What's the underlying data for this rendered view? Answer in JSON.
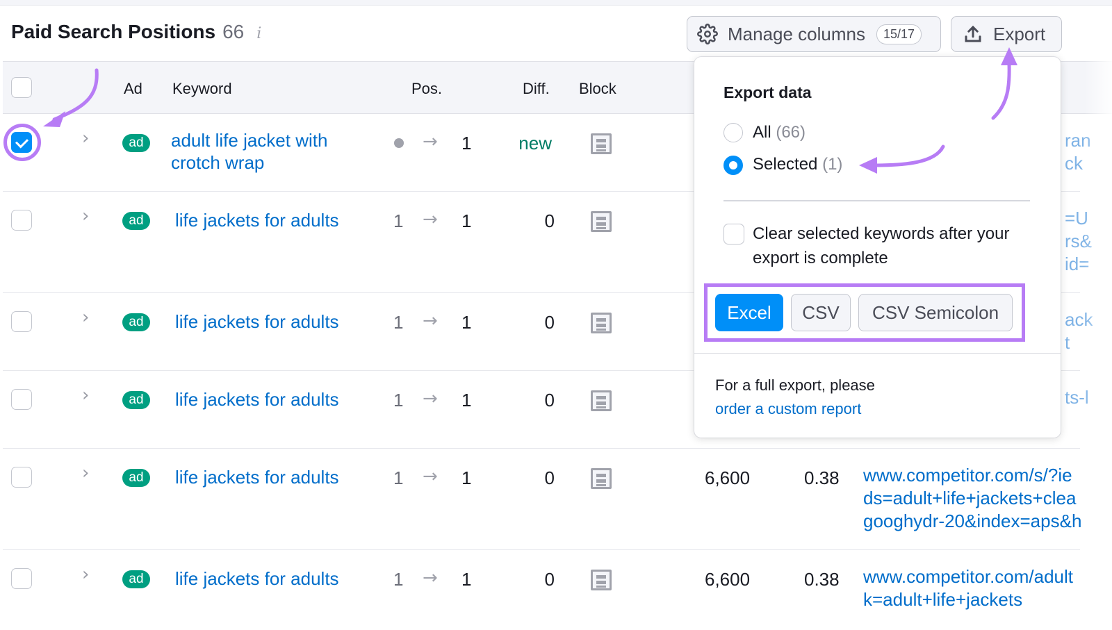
{
  "header": {
    "title": "Paid Search Positions",
    "count": "66",
    "info_icon": "i"
  },
  "toolbar": {
    "manage_columns_label": "Manage columns",
    "manage_columns_badge": "15/17",
    "export_label": "Export"
  },
  "table": {
    "columns": {
      "ad": "Ad",
      "keyword": "Keyword",
      "pos": "Pos.",
      "diff": "Diff.",
      "block": "Block"
    },
    "rows": [
      {
        "checked": true,
        "ad": "ad",
        "keyword_line1": "adult life jacket with",
        "keyword_line2": "crotch wrap",
        "pos_prev": "",
        "arrow": "→",
        "pos_cur": "1",
        "diff": "new",
        "url_fragment": "ran\nck"
      },
      {
        "checked": false,
        "ad": "ad",
        "keyword_line1": "life jackets for adults",
        "pos_prev": "1",
        "arrow": "→",
        "pos_cur": "1",
        "diff": "0",
        "url_fragment": "=U\nrs&\nid="
      },
      {
        "checked": false,
        "ad": "ad",
        "keyword_line1": "life jackets for adults",
        "pos_prev": "1",
        "arrow": "→",
        "pos_cur": "1",
        "diff": "0",
        "url_fragment": "ack\nt"
      },
      {
        "checked": false,
        "ad": "ad",
        "keyword_line1": "life jackets for adults",
        "pos_prev": "1",
        "arrow": "→",
        "pos_cur": "1",
        "diff": "0",
        "url_fragment": "ts-l"
      },
      {
        "checked": false,
        "ad": "ad",
        "keyword_line1": "life jackets for adults",
        "pos_prev": "1",
        "arrow": "→",
        "pos_cur": "1",
        "diff": "0",
        "volume": "6,600",
        "cpc": "0.38",
        "url": "www.competitor.com/s/?ie\nds=adult+life+jackets+clea\ngooghydr-20&index=aps&h"
      },
      {
        "checked": false,
        "ad": "ad",
        "keyword_line1": "life jackets for adults",
        "pos_prev": "1",
        "arrow": "→",
        "pos_cur": "1",
        "diff": "0",
        "volume": "6,600",
        "cpc": "0.38",
        "url": "www.competitor.com/adult\nk=adult+life+jackets"
      }
    ]
  },
  "export_popup": {
    "title": "Export data",
    "options": [
      {
        "label": "All",
        "count": "(66)",
        "selected": false
      },
      {
        "label": "Selected",
        "count": "(1)",
        "selected": true
      }
    ],
    "clear_checkbox_label": "Clear selected keywords after your export is complete",
    "formats": [
      "Excel",
      "CSV",
      "CSV Semicolon"
    ],
    "active_format": "Excel",
    "footer_text": "For a full export, please",
    "footer_link": "order a custom report"
  },
  "colors": {
    "accent_blue": "#008ff8",
    "link_blue": "#006dca",
    "ad_green": "#009f81",
    "new_green": "#007c65",
    "annotation_purple": "#b77cf5"
  }
}
